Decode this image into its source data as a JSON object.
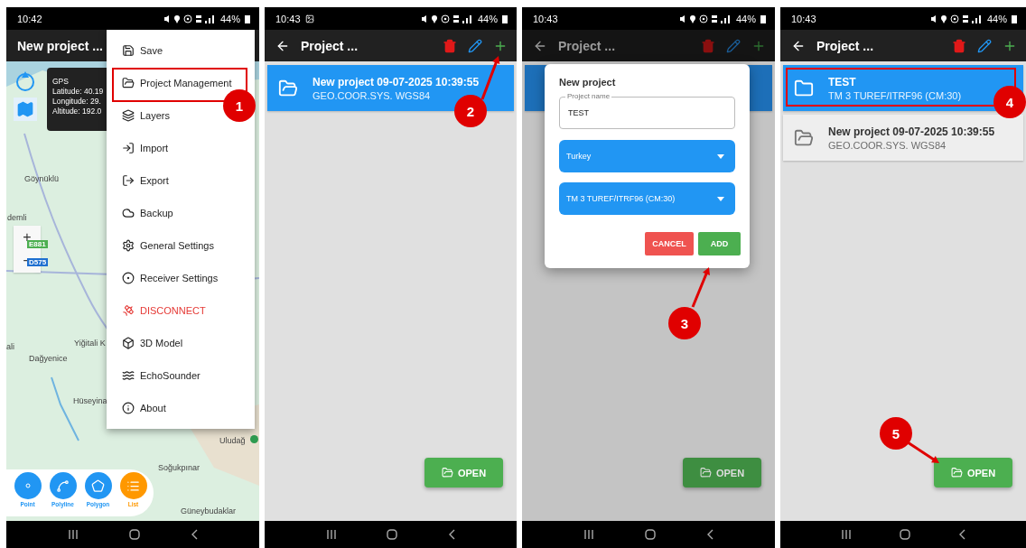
{
  "panels": [
    {
      "kind": "map",
      "status": {
        "time": "10:42",
        "battery": "44%",
        "gallery_notice": false
      },
      "title": "New project ...",
      "gps": {
        "title": "GPS",
        "lines": [
          "Latitude: 40.19",
          "Longitude: 29.",
          "Altitude: 192.0"
        ]
      },
      "zoom": [
        "+",
        "−"
      ],
      "roads": [
        {
          "label": "E881",
          "color": "#4caf50"
        },
        {
          "label": "D575",
          "color": "#1e6fd0"
        }
      ],
      "map_labels": [
        "Göynüklü",
        "demli",
        "ali",
        "Yiğitali K",
        "Dağyenice",
        "Hüseyina",
        "Uludağ",
        "Soğukpınar",
        "Güneybudaklar"
      ],
      "menu": [
        {
          "label": "Save",
          "kind": "normal"
        },
        {
          "label": "Project Management",
          "kind": "normal"
        },
        {
          "label": "Layers",
          "kind": "normal"
        },
        {
          "label": "Import",
          "kind": "normal"
        },
        {
          "label": "Export",
          "kind": "normal"
        },
        {
          "label": "Backup",
          "kind": "normal"
        },
        {
          "label": "General Settings",
          "kind": "normal"
        },
        {
          "label": "Receiver Settings",
          "kind": "normal"
        },
        {
          "label": "DISCONNECT",
          "kind": "danger"
        },
        {
          "label": "3D Model",
          "kind": "normal"
        },
        {
          "label": "EchoSounder",
          "kind": "normal"
        },
        {
          "label": "About",
          "kind": "normal"
        }
      ],
      "tools": [
        {
          "label": "Point",
          "selected": false
        },
        {
          "label": "Polyline",
          "selected": false
        },
        {
          "label": "Polygon",
          "selected": false
        },
        {
          "label": "List",
          "selected": true
        }
      ]
    },
    {
      "kind": "list",
      "status": {
        "time": "10:43",
        "battery": "44%",
        "gallery_notice": true
      },
      "title": "Project ...",
      "projects": [
        {
          "name": "New project 09-07-2025 10:39:55",
          "system": "GEO.COOR.SYS. WGS84",
          "selected": true
        }
      ],
      "open_button": "OPEN"
    },
    {
      "kind": "dialog",
      "status": {
        "time": "10:43",
        "battery": "44%",
        "gallery_notice": false
      },
      "title": "Project ...",
      "projects": [
        {
          "selected": true
        }
      ],
      "open_button": "OPEN",
      "dialog": {
        "title": "New project",
        "field": {
          "label": "Project name",
          "value": "TEST"
        },
        "selects": [
          "Turkey",
          "TM 3 TUREF/ITRF96 (CM:30)"
        ],
        "buttons": [
          {
            "label": "CANCEL",
            "kind": "cancel"
          },
          {
            "label": "ADD",
            "kind": "confirm"
          }
        ]
      }
    },
    {
      "kind": "list",
      "status": {
        "time": "10:43",
        "battery": "44%",
        "gallery_notice": false
      },
      "title": "Project ...",
      "projects": [
        {
          "name": "TEST",
          "system": "TM 3 TUREF/ITRF96 (CM:30)",
          "selected": true
        },
        {
          "name": "New project 09-07-2025 10:39:55",
          "system": "GEO.COOR.SYS. WGS84",
          "selected": false
        }
      ],
      "open_button": "OPEN"
    }
  ],
  "annotations": [
    {
      "number": "1"
    },
    {
      "number": "2"
    },
    {
      "number": "3"
    },
    {
      "number": "4"
    },
    {
      "number": "5"
    }
  ]
}
